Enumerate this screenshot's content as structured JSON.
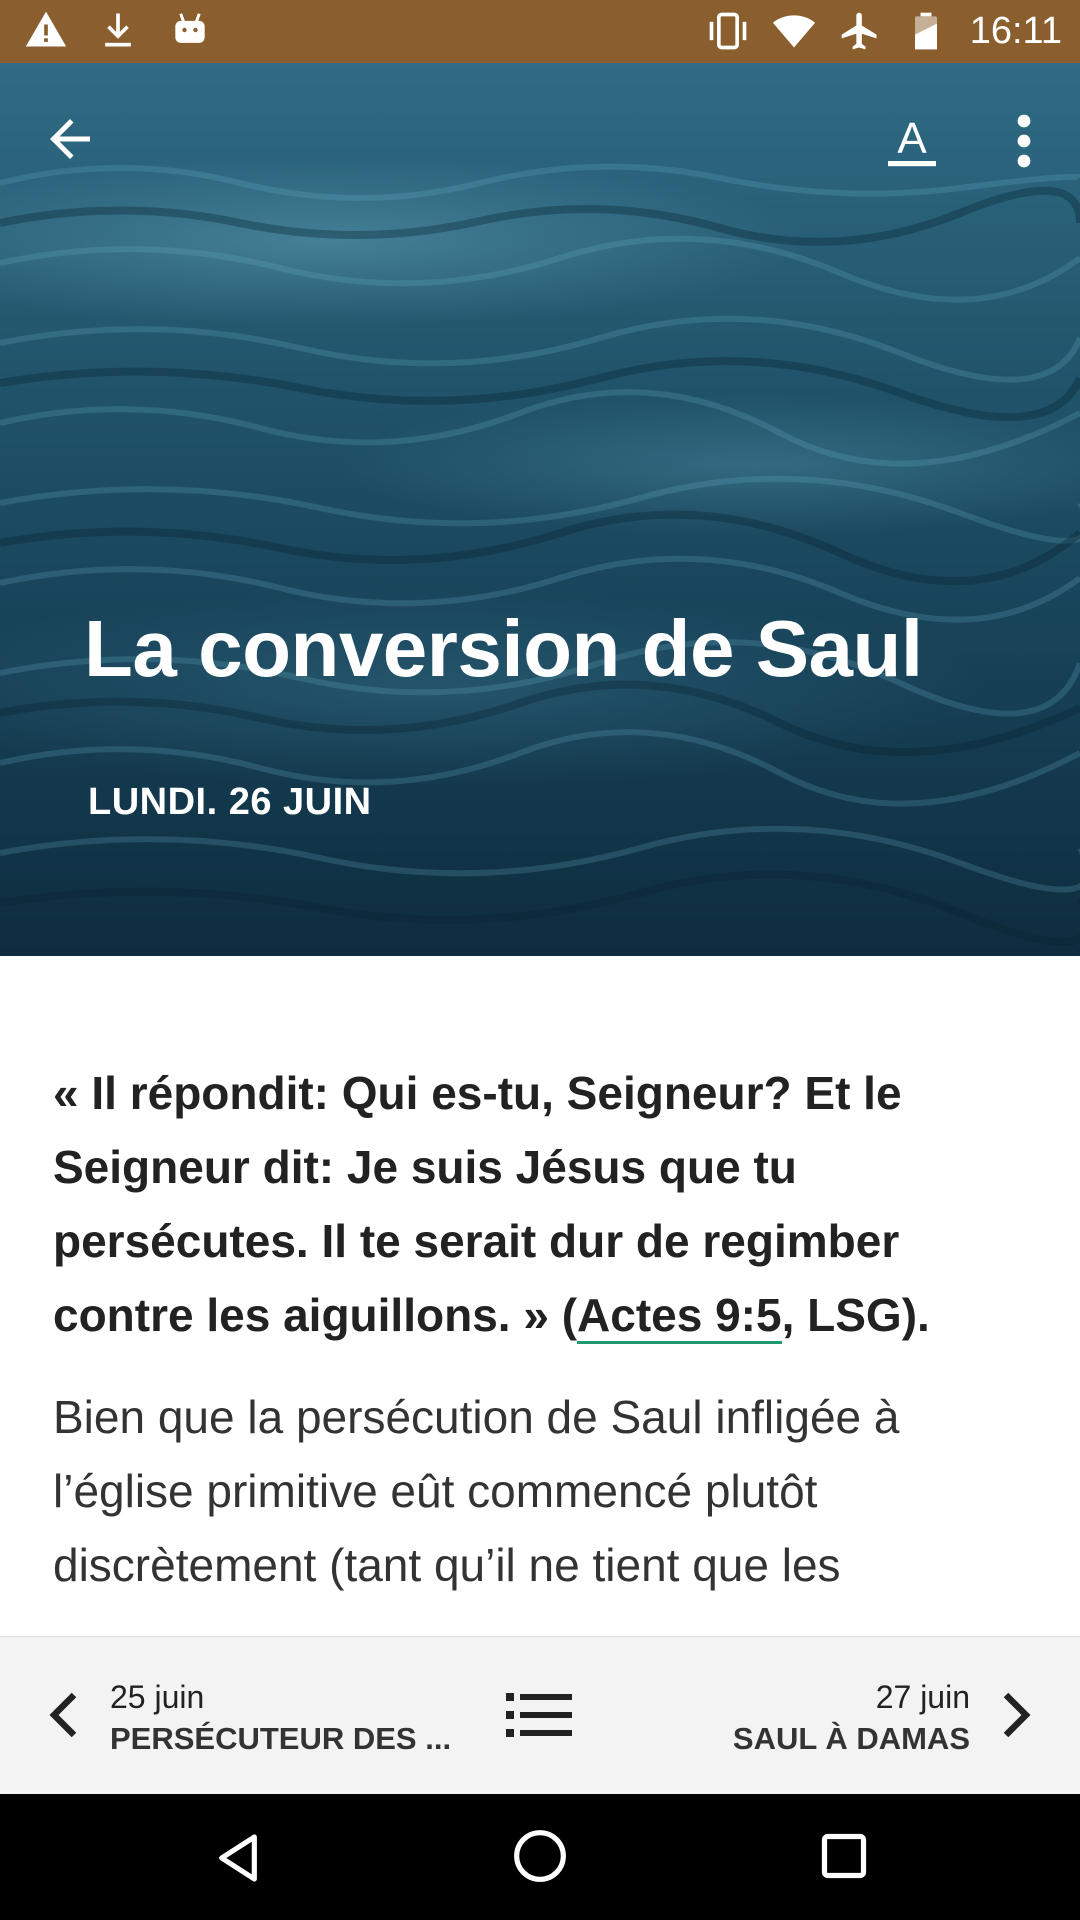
{
  "status_bar": {
    "time": "16:11",
    "left_icons": [
      "warning-icon",
      "download-icon",
      "android-icon"
    ],
    "right_icons": [
      "vibrate-icon",
      "wifi-icon",
      "airplane-icon",
      "battery-icon"
    ],
    "color": "#8b5e2e"
  },
  "toolbar": {
    "back_icon": "arrow-left-icon",
    "font_icon": "text-format-icon",
    "font_label": "A",
    "more_icon": "more-vert-icon"
  },
  "hero": {
    "title": "La conversion de Saul",
    "date": "LUNDI. 26 JUIN"
  },
  "content": {
    "verse_before_ref": "« Il répondit: Qui es-tu, Seigneur? Et le Seigneur dit: Je suis Jésus que tu persécutes. Il te serait dur de regimber contre les aiguillons. » (",
    "verse_ref": "Actes 9:5",
    "verse_after_ref": ", LSG).",
    "body": "Bien que la persécution de Saul infligée à l’église primitive eût commencé plutôt discrètement (tant qu’il ne tient que les",
    "link_color": "#1e9a6e"
  },
  "bottom_nav": {
    "prev_date": "25 juin",
    "prev_title": "PERSÉCUTEUR DES ...",
    "next_date": "27 juin",
    "next_title": "SAUL À DAMAS",
    "list_icon": "list-icon"
  },
  "system_nav": {
    "back_icon": "nav-back-icon",
    "home_icon": "nav-home-icon",
    "recent_icon": "nav-recent-icon"
  }
}
